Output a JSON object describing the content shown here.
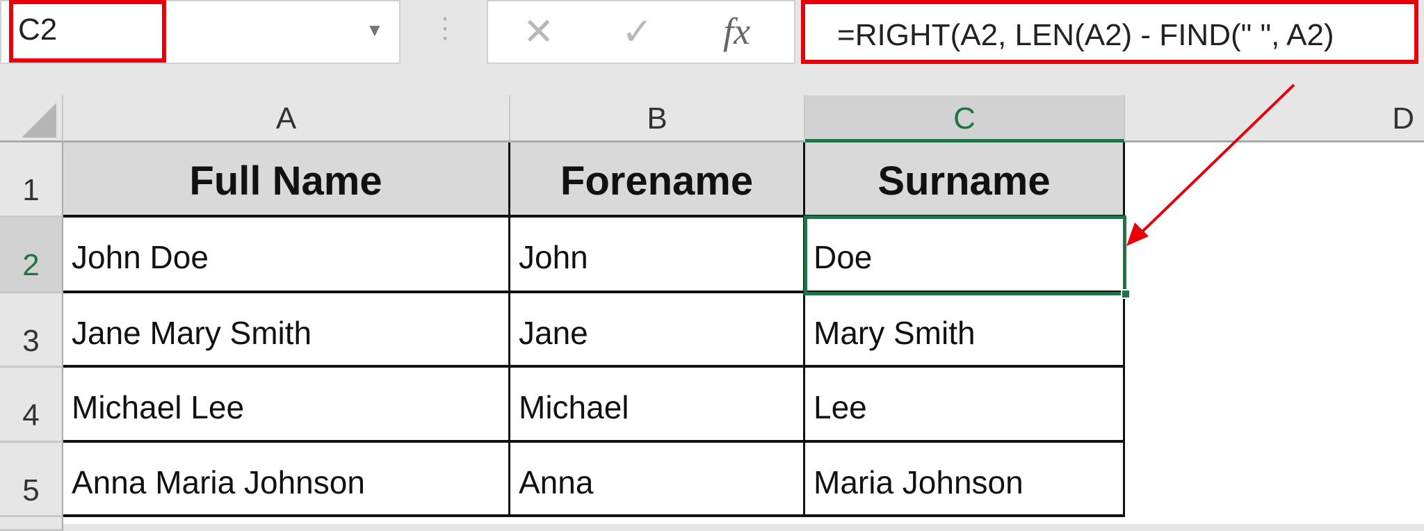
{
  "name_box": {
    "value": "C2"
  },
  "formula_bar": {
    "cancel_icon": "✕",
    "enter_icon": "✓",
    "fx_label": "fx",
    "formula": "=RIGHT(A2, LEN(A2) - FIND(\" \", A2)"
  },
  "columns": [
    "A",
    "B",
    "C",
    "D"
  ],
  "rows": [
    "1",
    "2",
    "3",
    "4",
    "5"
  ],
  "table": {
    "headers": [
      "Full Name",
      "Forename",
      "Surname"
    ],
    "data": [
      [
        "John Doe",
        "John",
        "Doe"
      ],
      [
        "Jane Mary Smith",
        "Jane",
        "Mary Smith"
      ],
      [
        "Michael Lee",
        "Michael",
        "Lee"
      ],
      [
        "Anna Maria Johnson",
        "Anna",
        "Maria Johnson"
      ]
    ]
  },
  "colors": {
    "highlight": "#e8000b",
    "selection": "#217346"
  }
}
